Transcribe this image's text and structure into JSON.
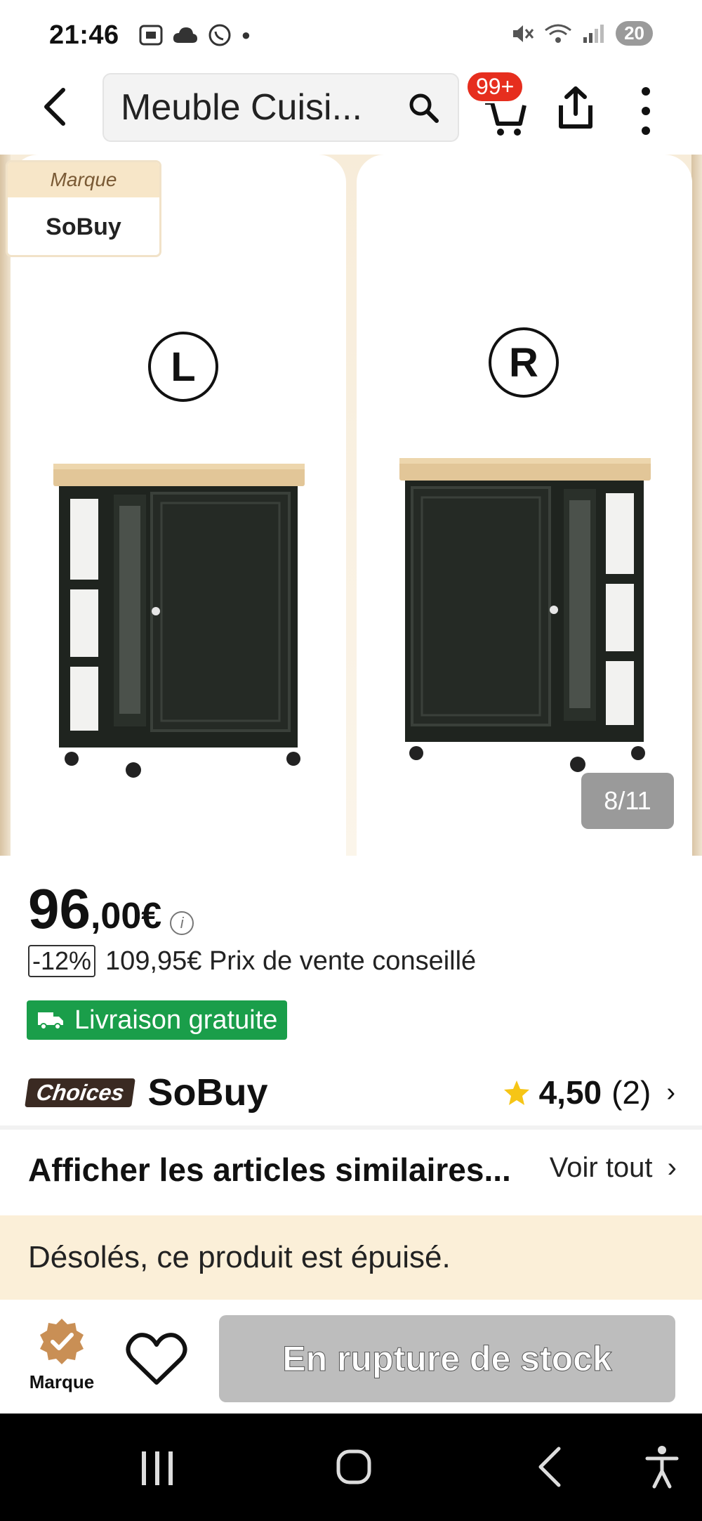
{
  "status_bar": {
    "time": "21:46",
    "battery": "20",
    "left_icons": [
      "screenshot-icon",
      "cloud-icon",
      "whatsapp-icon",
      "dot-icon"
    ],
    "right_icons": [
      "mute-icon",
      "wifi-icon",
      "signal-icon"
    ]
  },
  "header": {
    "search_text": "Meuble Cuisi...",
    "cart_badge": "99+"
  },
  "gallery": {
    "brand_card_label": "Marque",
    "brand_card_name": "SoBuy",
    "left_label": "L",
    "right_label": "R",
    "counter": "8/11"
  },
  "product": {
    "price_int": "96",
    "price_dec": ",00€",
    "discount": "-12%",
    "old_price_text": "109,95€ Prix de vente conseillé",
    "free_shipping": "Livraison gratuite",
    "choices_badge": "Choices",
    "seller_name": "SoBuy",
    "rating_value": "4,50",
    "rating_count": "(2)"
  },
  "similar": {
    "title": "Afficher les articles similaires...",
    "see_all": "Voir tout"
  },
  "sold_out_message": "Désolés, ce produit est épuisé.",
  "actions": {
    "brand_label": "Marque",
    "out_of_stock_label": "En rupture de stock"
  },
  "colors": {
    "free_shipping_green": "#1a9e4a",
    "cart_badge_red": "#e62e1e",
    "sold_out_banner": "#fbefd8",
    "star": "#f6c516"
  }
}
